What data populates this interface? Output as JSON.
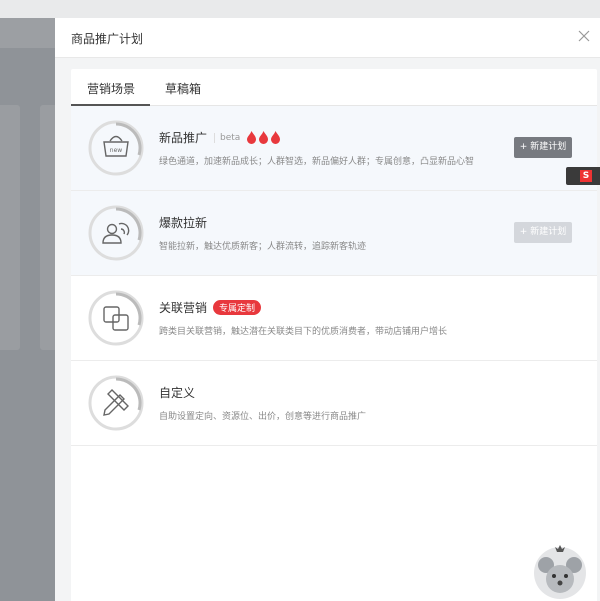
{
  "drawer": {
    "title": "商品推广计划"
  },
  "tabs": [
    {
      "label": "营销场景"
    },
    {
      "label": "草稿箱"
    }
  ],
  "items": [
    {
      "title": "新品推广",
      "beta": "beta",
      "icon_text": "new",
      "desc": "绿色通道，加速新品成长；人群智选，新品偏好人群；专属创意，凸显新品心智",
      "button": "+ 新建计划"
    },
    {
      "title": "爆款拉新",
      "desc": "智能拉新，触达优质新客；人群流转，追踪新客轨迹",
      "button": "+ 新建计划"
    },
    {
      "title": "关联营销",
      "badge": "专属定制",
      "desc": "跨类目关联营销，触达潜在关联类目下的优质消费者，带动店铺用户增长"
    },
    {
      "title": "自定义",
      "desc": "自助设置定向、资源位、出价，创意等进行商品推广"
    }
  ],
  "side_float": {
    "label": "S"
  },
  "colors": {
    "flame": "#e8383d",
    "badge": "#e8383d",
    "button_dark": "#777a80",
    "button_light": "#d4d7dc"
  }
}
